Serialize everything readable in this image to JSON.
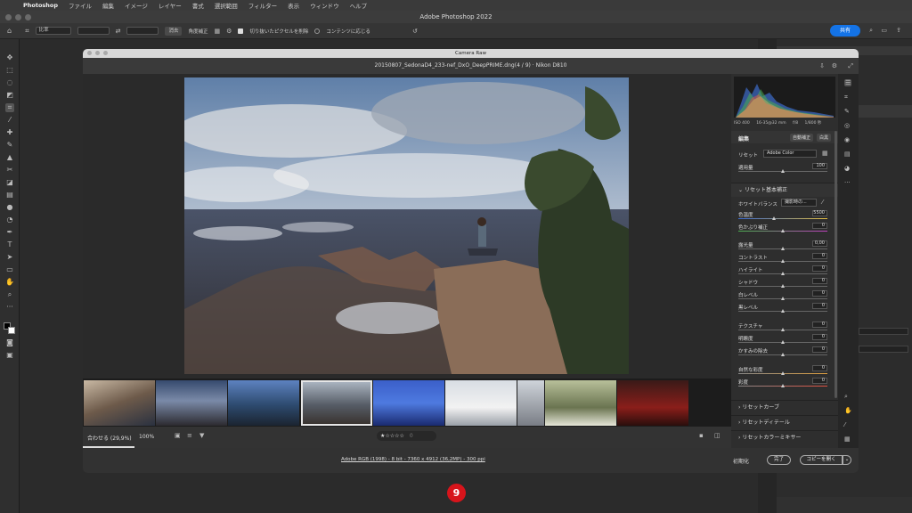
{
  "menubar": {
    "apple": "",
    "app": "Photoshop",
    "items": [
      "ファイル",
      "編集",
      "イメージ",
      "レイヤー",
      "書式",
      "選択範囲",
      "フィルター",
      "表示",
      "ウィンドウ",
      "ヘルプ"
    ]
  },
  "window": {
    "title": "Adobe Photoshop 2022"
  },
  "options": {
    "ratio": "比率",
    "clear": "消去",
    "straighten": "角度補正",
    "delete_pixels": "切り抜いたピクセルを削除",
    "content_aware": "コンテンツに応じる",
    "share": "共有"
  },
  "camera_raw": {
    "title": "Camera Raw",
    "filename": "20150807_SedonaD4_233-nef_DxO_DeepPRIME.dng(4 / 9)  ·  Nikon D810",
    "exif": {
      "iso": "ISO 400",
      "lens": "16-35@32 mm",
      "fstop": "f/8",
      "shutter": "1/800 秒"
    },
    "panel": {
      "edit": "編集",
      "auto": "自動補正",
      "bw": "白黒",
      "preset_label": "リセット",
      "profile": "Adobe Color",
      "amount_label": "適用量",
      "amount_value": "100",
      "basic": "リセット基本補正",
      "wb_label": "ホワイトバランス",
      "wb_value": "撮影時の...",
      "sliders": [
        {
          "label": "色温度",
          "value": "5500"
        },
        {
          "label": "色かぶり補正",
          "value": "0"
        },
        {
          "label": "露光量",
          "value": "0,00"
        },
        {
          "label": "コントラスト",
          "value": "0"
        },
        {
          "label": "ハイライト",
          "value": "0"
        },
        {
          "label": "シャドウ",
          "value": "0"
        },
        {
          "label": "白レベル",
          "value": "0"
        },
        {
          "label": "黒レベル",
          "value": "0"
        },
        {
          "label": "テクスチャ",
          "value": "0"
        },
        {
          "label": "明瞭度",
          "value": "0"
        },
        {
          "label": "かすみの除去",
          "value": "0"
        },
        {
          "label": "自然な彩度",
          "value": "0"
        },
        {
          "label": "彩度",
          "value": "0"
        }
      ],
      "sections": [
        "リセットカーブ",
        "リセットディテール",
        "リセットカラーミキサー"
      ]
    },
    "bottom": {
      "fit": "合わせる (29,9%)",
      "zoom": "100%",
      "rating_extra": "0"
    },
    "status": "Adobe RGB (1998) - 8 bit - 7360 x 4912 (36,2MP) - 300 ppi",
    "buttons": {
      "reset": "初期化",
      "done": "完了",
      "open": "コピーを開く"
    }
  },
  "step_badge": "9",
  "colors": {
    "accent": "#1473e6",
    "badge": "#d7141b"
  }
}
